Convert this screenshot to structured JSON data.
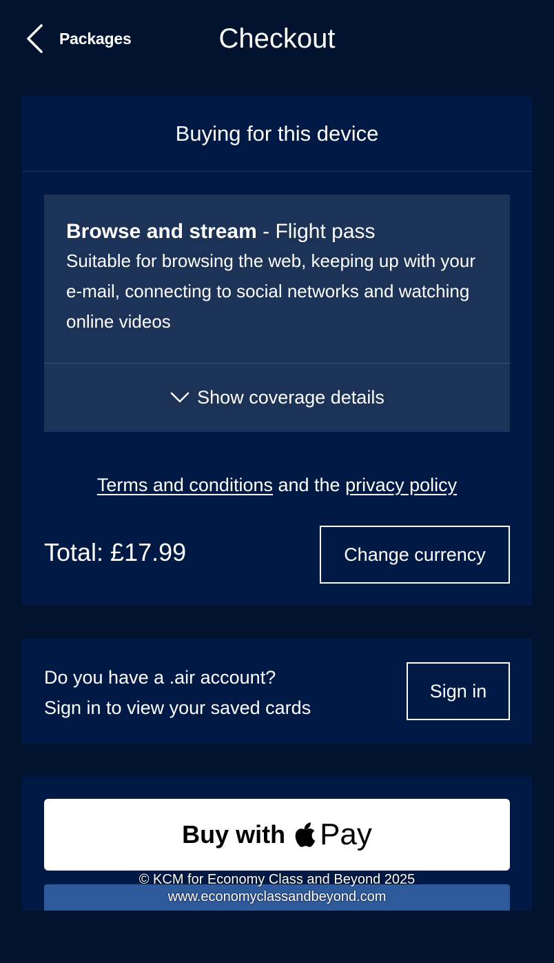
{
  "header": {
    "back_label": "Packages",
    "title": "Checkout"
  },
  "purchase": {
    "title": "Buying for this device",
    "package": {
      "name": "Browse and stream",
      "separator": " - ",
      "type": "Flight pass",
      "description": "Suitable for browsing the web, keeping up with your e-mail, connecting to social networks and watching online videos"
    },
    "coverage_label": "Show coverage details",
    "terms_link": "Terms and conditions",
    "terms_middle": " and the ",
    "privacy_link": "privacy policy",
    "total": "Total: £17.99",
    "change_currency": "Change currency"
  },
  "account": {
    "line1": "Do you have a .air account?",
    "line2": "Sign in to view your saved cards",
    "sign_in": "Sign in"
  },
  "payment": {
    "apple_pay_prefix": "Buy with",
    "apple_pay_word": "Pay"
  },
  "watermark": {
    "line1": "© KCM for Economy Class and Beyond 2025",
    "line2": "www.economyclassandbeyond.com"
  },
  "icons": {
    "back": "chevron-left-icon",
    "coverage": "chevron-down-icon",
    "apple": "apple-logo-icon"
  },
  "colors": {
    "background": "#021330",
    "card": "#011a45",
    "package": "#1c3256",
    "strip": "#2e5a9c"
  }
}
